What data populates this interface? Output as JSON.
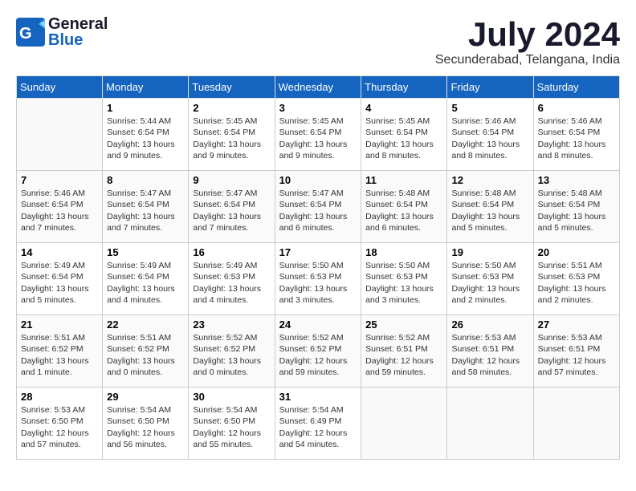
{
  "header": {
    "logo_line1": "General",
    "logo_line2": "Blue",
    "month": "July 2024",
    "location": "Secunderabad, Telangana, India"
  },
  "columns": [
    "Sunday",
    "Monday",
    "Tuesday",
    "Wednesday",
    "Thursday",
    "Friday",
    "Saturday"
  ],
  "weeks": [
    [
      {
        "day": "",
        "info": ""
      },
      {
        "day": "1",
        "info": "Sunrise: 5:44 AM\nSunset: 6:54 PM\nDaylight: 13 hours and 9 minutes."
      },
      {
        "day": "2",
        "info": "Sunrise: 5:45 AM\nSunset: 6:54 PM\nDaylight: 13 hours and 9 minutes."
      },
      {
        "day": "3",
        "info": "Sunrise: 5:45 AM\nSunset: 6:54 PM\nDaylight: 13 hours and 9 minutes."
      },
      {
        "day": "4",
        "info": "Sunrise: 5:45 AM\nSunset: 6:54 PM\nDaylight: 13 hours and 8 minutes."
      },
      {
        "day": "5",
        "info": "Sunrise: 5:46 AM\nSunset: 6:54 PM\nDaylight: 13 hours and 8 minutes."
      },
      {
        "day": "6",
        "info": "Sunrise: 5:46 AM\nSunset: 6:54 PM\nDaylight: 13 hours and 8 minutes."
      }
    ],
    [
      {
        "day": "7",
        "info": "Sunrise: 5:46 AM\nSunset: 6:54 PM\nDaylight: 13 hours and 7 minutes."
      },
      {
        "day": "8",
        "info": "Sunrise: 5:47 AM\nSunset: 6:54 PM\nDaylight: 13 hours and 7 minutes."
      },
      {
        "day": "9",
        "info": "Sunrise: 5:47 AM\nSunset: 6:54 PM\nDaylight: 13 hours and 7 minutes."
      },
      {
        "day": "10",
        "info": "Sunrise: 5:47 AM\nSunset: 6:54 PM\nDaylight: 13 hours and 6 minutes."
      },
      {
        "day": "11",
        "info": "Sunrise: 5:48 AM\nSunset: 6:54 PM\nDaylight: 13 hours and 6 minutes."
      },
      {
        "day": "12",
        "info": "Sunrise: 5:48 AM\nSunset: 6:54 PM\nDaylight: 13 hours and 5 minutes."
      },
      {
        "day": "13",
        "info": "Sunrise: 5:48 AM\nSunset: 6:54 PM\nDaylight: 13 hours and 5 minutes."
      }
    ],
    [
      {
        "day": "14",
        "info": "Sunrise: 5:49 AM\nSunset: 6:54 PM\nDaylight: 13 hours and 5 minutes."
      },
      {
        "day": "15",
        "info": "Sunrise: 5:49 AM\nSunset: 6:54 PM\nDaylight: 13 hours and 4 minutes."
      },
      {
        "day": "16",
        "info": "Sunrise: 5:49 AM\nSunset: 6:53 PM\nDaylight: 13 hours and 4 minutes."
      },
      {
        "day": "17",
        "info": "Sunrise: 5:50 AM\nSunset: 6:53 PM\nDaylight: 13 hours and 3 minutes."
      },
      {
        "day": "18",
        "info": "Sunrise: 5:50 AM\nSunset: 6:53 PM\nDaylight: 13 hours and 3 minutes."
      },
      {
        "day": "19",
        "info": "Sunrise: 5:50 AM\nSunset: 6:53 PM\nDaylight: 13 hours and 2 minutes."
      },
      {
        "day": "20",
        "info": "Sunrise: 5:51 AM\nSunset: 6:53 PM\nDaylight: 13 hours and 2 minutes."
      }
    ],
    [
      {
        "day": "21",
        "info": "Sunrise: 5:51 AM\nSunset: 6:52 PM\nDaylight: 13 hours and 1 minute."
      },
      {
        "day": "22",
        "info": "Sunrise: 5:51 AM\nSunset: 6:52 PM\nDaylight: 13 hours and 0 minutes."
      },
      {
        "day": "23",
        "info": "Sunrise: 5:52 AM\nSunset: 6:52 PM\nDaylight: 13 hours and 0 minutes."
      },
      {
        "day": "24",
        "info": "Sunrise: 5:52 AM\nSunset: 6:52 PM\nDaylight: 12 hours and 59 minutes."
      },
      {
        "day": "25",
        "info": "Sunrise: 5:52 AM\nSunset: 6:51 PM\nDaylight: 12 hours and 59 minutes."
      },
      {
        "day": "26",
        "info": "Sunrise: 5:53 AM\nSunset: 6:51 PM\nDaylight: 12 hours and 58 minutes."
      },
      {
        "day": "27",
        "info": "Sunrise: 5:53 AM\nSunset: 6:51 PM\nDaylight: 12 hours and 57 minutes."
      }
    ],
    [
      {
        "day": "28",
        "info": "Sunrise: 5:53 AM\nSunset: 6:50 PM\nDaylight: 12 hours and 57 minutes."
      },
      {
        "day": "29",
        "info": "Sunrise: 5:54 AM\nSunset: 6:50 PM\nDaylight: 12 hours and 56 minutes."
      },
      {
        "day": "30",
        "info": "Sunrise: 5:54 AM\nSunset: 6:50 PM\nDaylight: 12 hours and 55 minutes."
      },
      {
        "day": "31",
        "info": "Sunrise: 5:54 AM\nSunset: 6:49 PM\nDaylight: 12 hours and 54 minutes."
      },
      {
        "day": "",
        "info": ""
      },
      {
        "day": "",
        "info": ""
      },
      {
        "day": "",
        "info": ""
      }
    ]
  ]
}
